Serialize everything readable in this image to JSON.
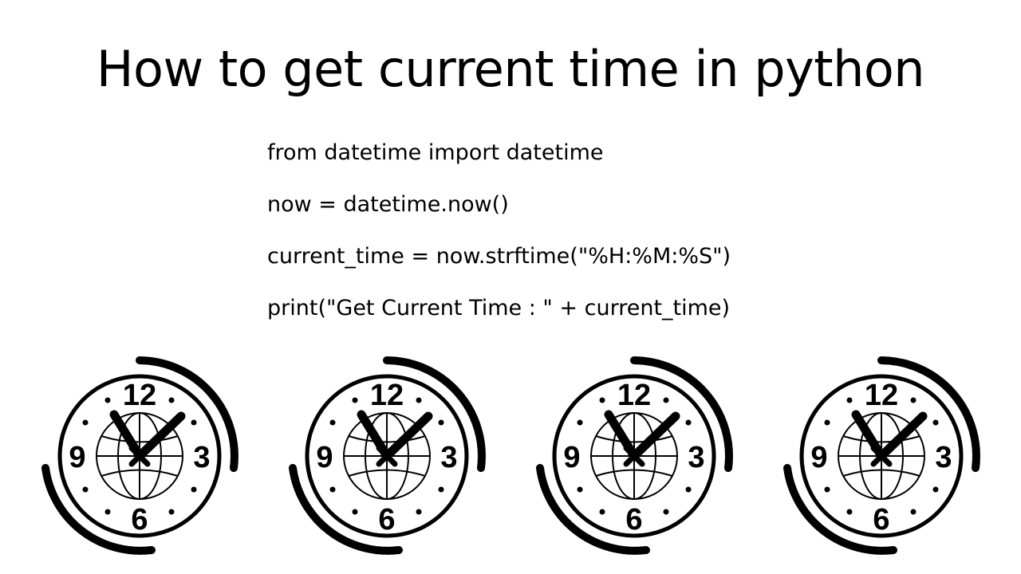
{
  "title": "How to get current time in python",
  "code": {
    "line1": "from datetime import datetime",
    "line2": "now = datetime.now()",
    "line3": "current_time = now.strftime(\"%H:%M:%S\")",
    "line4": "print(\"Get Current Time : \" + current_time)"
  },
  "clock": {
    "numerals": {
      "twelve": "12",
      "three": "3",
      "six": "6",
      "nine": "9"
    },
    "count": 4
  }
}
